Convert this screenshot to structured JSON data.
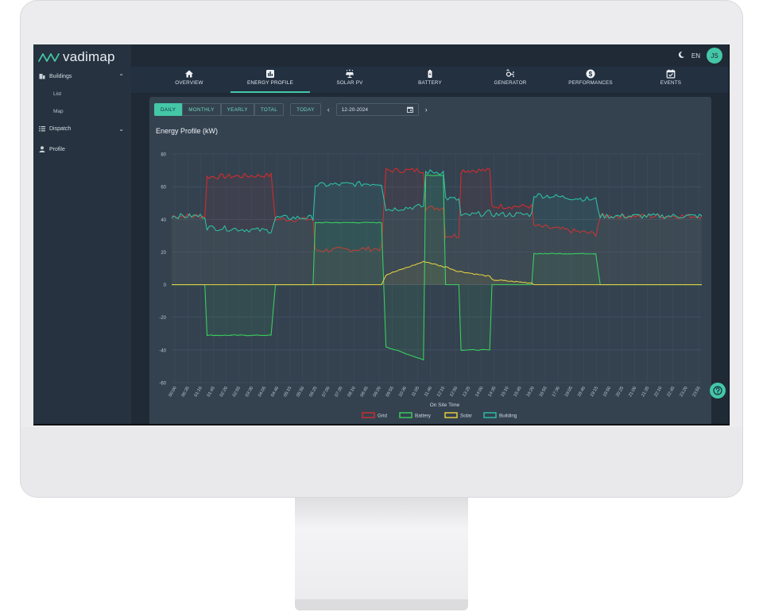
{
  "app": {
    "logo_text": "vadimap",
    "brand_color": "#44c7a7"
  },
  "sidebar": {
    "items": [
      {
        "label": "Buildings",
        "icon": "building-icon",
        "expanded": true,
        "children": [
          "List",
          "Map"
        ]
      },
      {
        "label": "Dispatch",
        "icon": "list-icon",
        "expanded": false
      },
      {
        "label": "Profile",
        "icon": "person-icon"
      }
    ]
  },
  "header": {
    "language": "EN",
    "user_initials": "JS",
    "theme_icon": "moon-icon"
  },
  "tabs": [
    {
      "label": "OVERVIEW",
      "icon": "home-icon",
      "active": false
    },
    {
      "label": "ENERGY PROFILE",
      "icon": "bar-chart-icon",
      "active": true
    },
    {
      "label": "SOLAR PV",
      "icon": "solar-panel-icon",
      "active": false
    },
    {
      "label": "BATTERY",
      "icon": "battery-icon",
      "active": false
    },
    {
      "label": "GENERATOR",
      "icon": "generator-icon",
      "active": false
    },
    {
      "label": "PERFORMANCES",
      "icon": "dollar-icon",
      "active": false
    },
    {
      "label": "EVENTS",
      "icon": "calendar-check-icon",
      "active": false
    }
  ],
  "controls": {
    "periods": [
      "DAILY",
      "MONTHLY",
      "YEARLY",
      "TOTAL"
    ],
    "active_period": "DAILY",
    "today_label": "TODAY",
    "date": "12-20-2024"
  },
  "chart_data": {
    "type": "line",
    "title": "Energy Profile (kW)",
    "xlabel": "On Site Time",
    "ylabel": "",
    "ylim": [
      -60,
      80
    ],
    "yticks": [
      80,
      60,
      40,
      20,
      0,
      -20,
      -40,
      -60
    ],
    "grid": true,
    "legend_placement": "bottom-center",
    "x_tick_labels": [
      "00:00",
      "00:35",
      "01:10",
      "01:45",
      "02:20",
      "02:55",
      "03:30",
      "04:05",
      "04:40",
      "05:15",
      "05:50",
      "06:25",
      "07:00",
      "07:35",
      "08:10",
      "08:45",
      "09:20",
      "09:55",
      "10:30",
      "11:05",
      "11:40",
      "12:15",
      "12:50",
      "13:25",
      "14:00",
      "14:35",
      "15:10",
      "15:45",
      "16:20",
      "16:55",
      "17:30",
      "18:05",
      "18:40",
      "19:15",
      "19:50",
      "20:25",
      "21:00",
      "21:35",
      "22:10",
      "22:45",
      "23:20",
      "23:55"
    ],
    "x_time_hours": [
      0,
      1.5,
      1.6,
      4.5,
      4.7,
      6.4,
      6.5,
      9.5,
      9.7,
      11.4,
      11.5,
      12.3,
      12.4,
      13.0,
      13.1,
      14.4,
      14.5,
      16.3,
      16.4,
      19.2,
      19.4,
      24
    ],
    "series": [
      {
        "name": "Grid",
        "color": "#d62b2b",
        "values": [
          42,
          42,
          66,
          67,
          40,
          40,
          21,
          22,
          70,
          70,
          47,
          47,
          30,
          30,
          70,
          70,
          48,
          48,
          36,
          31,
          42,
          42
        ]
      },
      {
        "name": "Battery",
        "color": "#3ad45c",
        "values": [
          0,
          0,
          -31,
          -31,
          0,
          0,
          38,
          38,
          -38,
          -46,
          67,
          67,
          0,
          0,
          -40,
          -40,
          0,
          0,
          19,
          19,
          0,
          0
        ]
      },
      {
        "name": "Solar",
        "color": "#f2d43a",
        "values": [
          0,
          0,
          0,
          0,
          0,
          0,
          0,
          0,
          6,
          14,
          14,
          11,
          11,
          8,
          8,
          5,
          3,
          1,
          0,
          0,
          0,
          0
        ]
      },
      {
        "name": "Building",
        "color": "#2bc4a6",
        "values": [
          42,
          42,
          35,
          33,
          41,
          41,
          61,
          62,
          46,
          48,
          69,
          69,
          53,
          52,
          42,
          44,
          43,
          43,
          55,
          52,
          42,
          42
        ]
      }
    ]
  }
}
